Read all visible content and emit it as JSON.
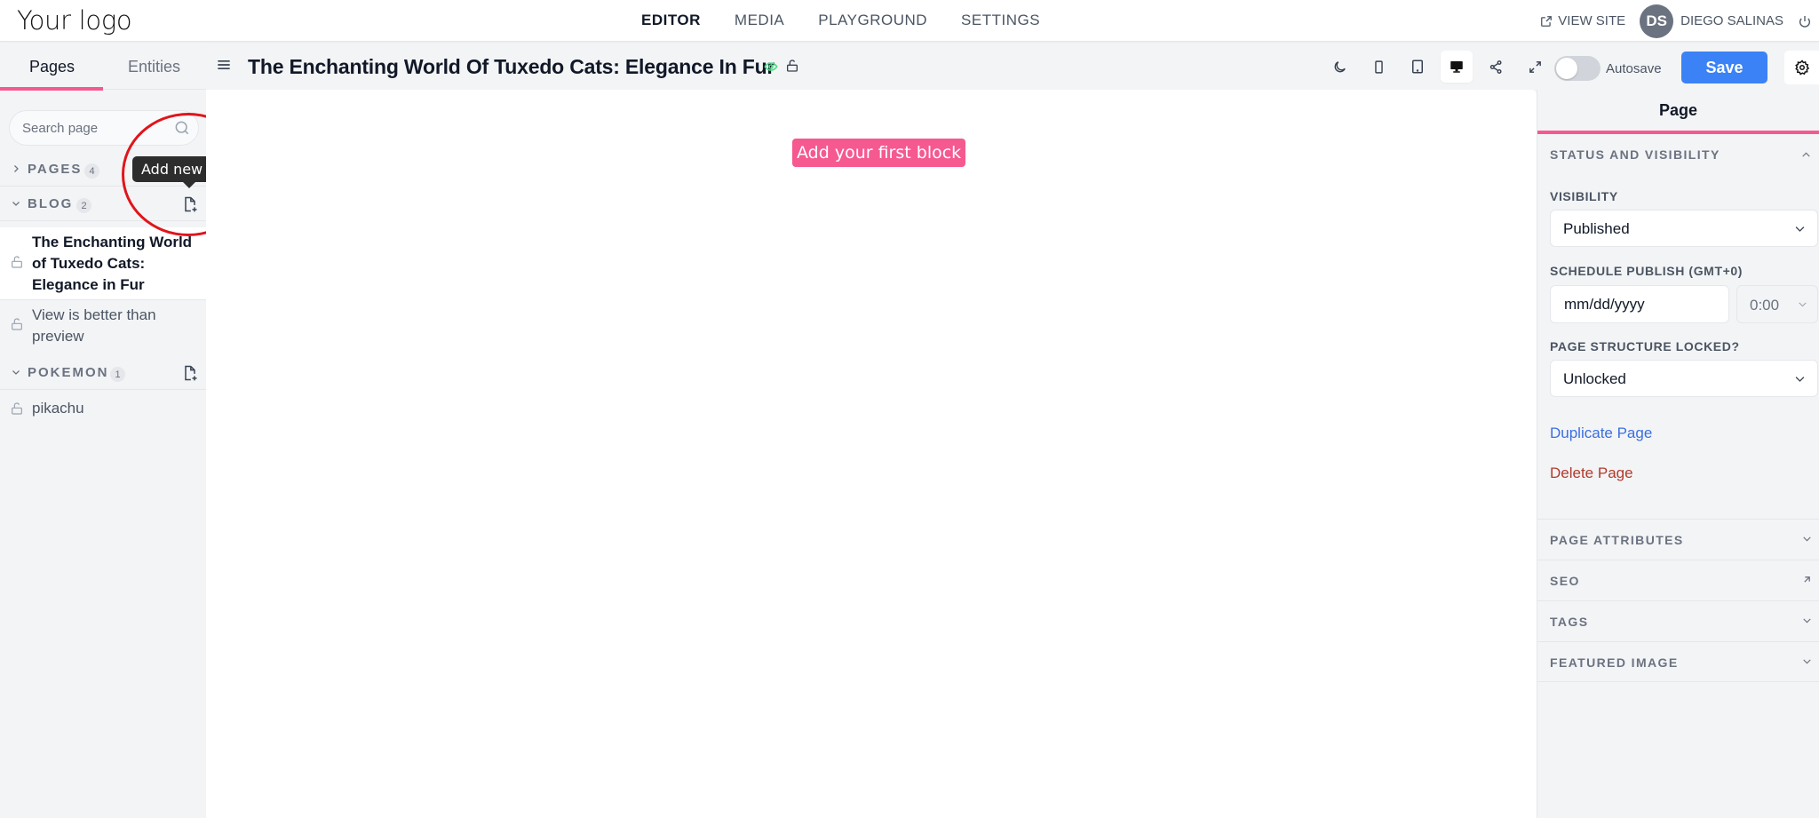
{
  "topbar": {
    "logo": "Your logo",
    "nav": [
      {
        "label": "EDITOR",
        "active": true
      },
      {
        "label": "MEDIA",
        "active": false
      },
      {
        "label": "PLAYGROUND",
        "active": false
      },
      {
        "label": "SETTINGS",
        "active": false
      }
    ],
    "view_site": "VIEW SITE",
    "avatar_initials": "DS",
    "user_name": "DIEGO SALINAS"
  },
  "sidebar": {
    "tabs": [
      {
        "label": "Pages",
        "active": true
      },
      {
        "label": "Entities",
        "active": false
      }
    ],
    "search_placeholder": "Search page",
    "groups": [
      {
        "name": "PAGES",
        "count": "4",
        "expanded": false
      },
      {
        "name": "BLOG",
        "count": "2",
        "expanded": true,
        "add_tooltip": "Add new blog"
      },
      {
        "name": "POKEMON",
        "count": "1",
        "expanded": true
      }
    ],
    "blog_items": [
      {
        "title": "The Enchanting World of Tuxedo Cats: Elegance in Fur",
        "active": true
      },
      {
        "title": "View is better than preview",
        "active": false
      }
    ],
    "pokemon_items": [
      {
        "title": "pikachu",
        "active": false
      }
    ],
    "tooltip": "Add new blog"
  },
  "editor": {
    "page_title": "The Enchanting World Of Tuxedo Cats: Elegance In Fur",
    "autosave_label": "Autosave",
    "autosave_on": false,
    "save_label": "Save",
    "add_block_label": "Add your first block",
    "device_active": "desktop"
  },
  "colors": {
    "accent_pink": "#f55990",
    "save_blue": "#3b82f6",
    "duplicate_link": "#3b6fe0",
    "delete_link": "#b23a2c",
    "published_eye": "#4ade80",
    "annotation_red": "#e0151b"
  },
  "panel": {
    "title": "Page",
    "status_section": "STATUS AND VISIBILITY",
    "visibility_label": "VISIBILITY",
    "visibility_value": "Published",
    "schedule_label": "SCHEDULE PUBLISH (GMT+0)",
    "date_placeholder": "mm/dd/yyyy",
    "time_value": "0:00",
    "locked_label": "PAGE STRUCTURE LOCKED?",
    "locked_value": "Unlocked",
    "duplicate_label": "Duplicate Page",
    "delete_label": "Delete Page",
    "sections": [
      {
        "label": "PAGE ATTRIBUTES",
        "icon": "chevron-down"
      },
      {
        "label": "SEO",
        "icon": "arrow-up-right"
      },
      {
        "label": "TAGS",
        "icon": "chevron-down"
      },
      {
        "label": "FEATURED IMAGE",
        "icon": "chevron-down"
      }
    ]
  }
}
